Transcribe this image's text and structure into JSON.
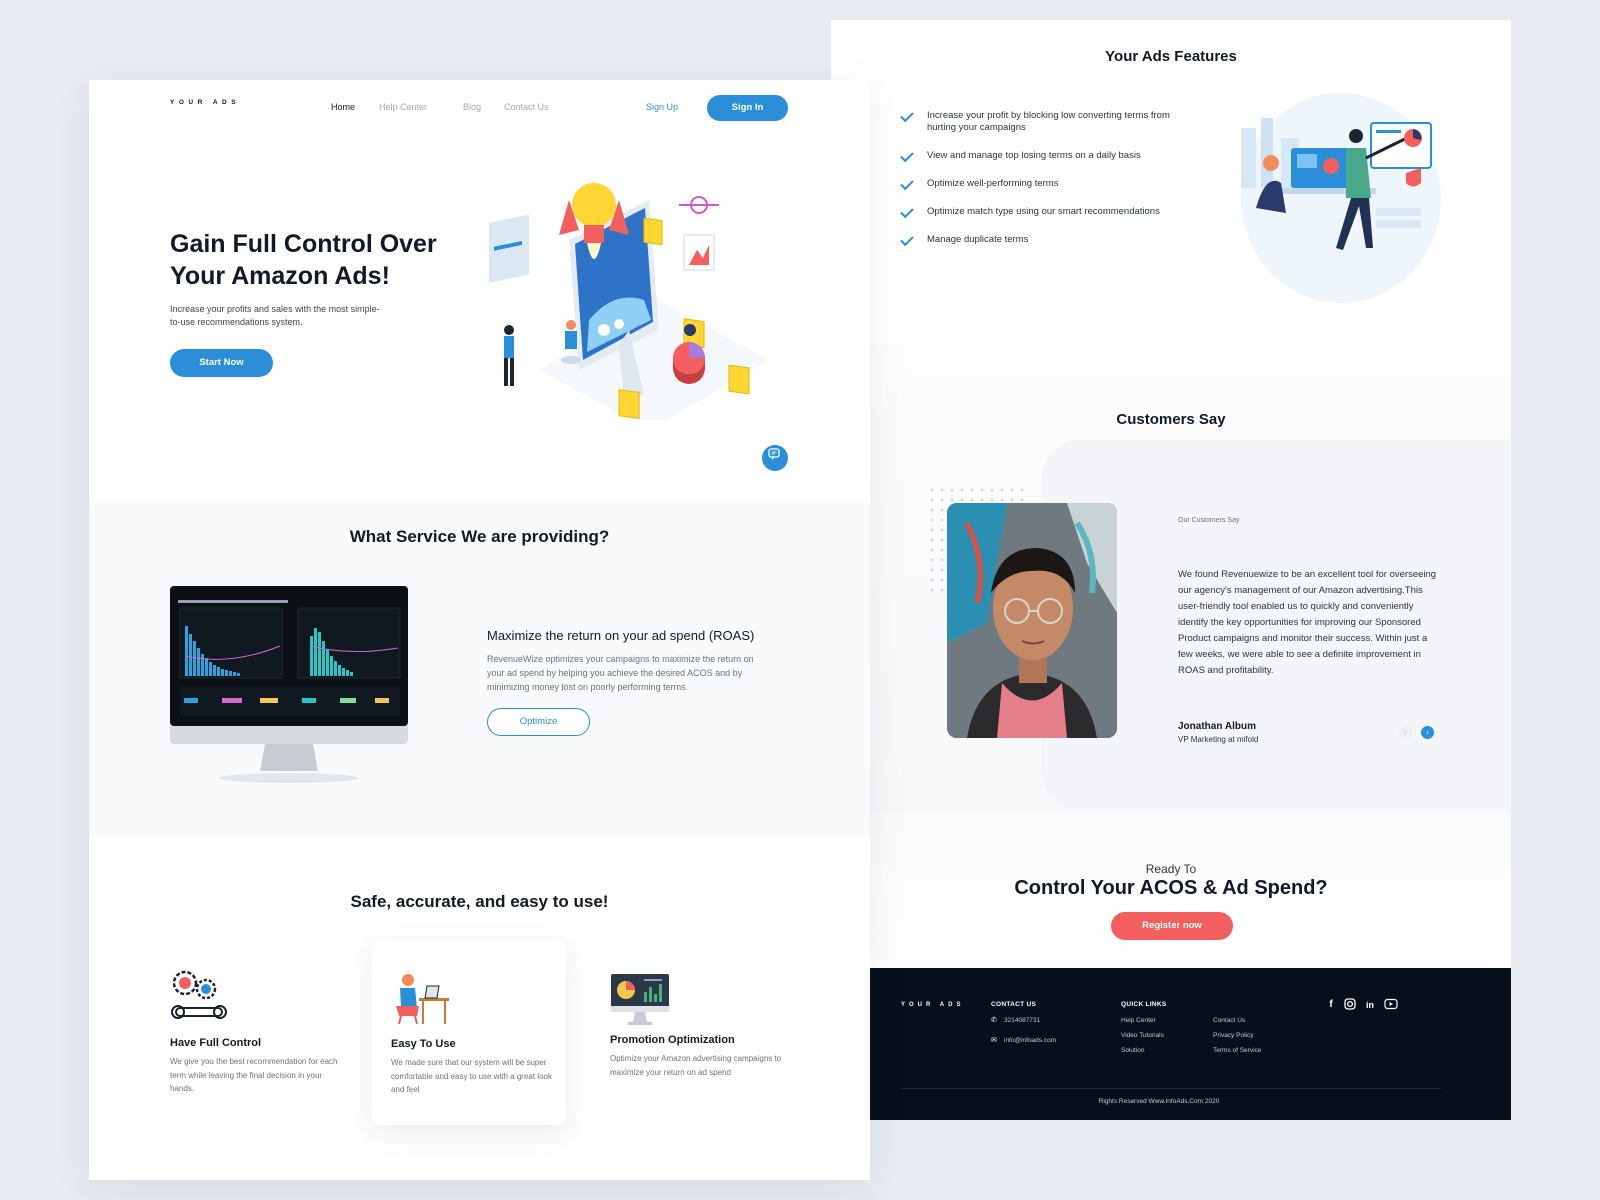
{
  "left_page": {
    "logo": "YOUR ADS",
    "nav": [
      {
        "label": "Home",
        "active": true
      },
      {
        "label": "Help Center",
        "active": false
      },
      {
        "label": "Blog",
        "active": false
      },
      {
        "label": "Contact Us",
        "active": false
      }
    ],
    "sign_up": "Sign Up",
    "sign_in": "Sign In",
    "hero": {
      "title": "Gain Full Control Over Your Amazon Ads!",
      "subtitle": "Increase your profits and sales with the most simple-to-use recommendations system.",
      "cta": "Start Now"
    },
    "service": {
      "heading": "What Service We are providing?",
      "title": "Maximize the return on your ad spend (ROAS)",
      "description": "RevenueWize optimizes your campaigns to maximize the return on your ad spend by helping you achieve the desired ACOS and by minimizing money lost on poorly performing terms.",
      "button": "Optimize"
    },
    "safe": {
      "heading": "Safe, accurate, and easy to use!",
      "tiles": [
        {
          "title": "Have Full Control",
          "desc": "We give you the best recommendation for each term while leaving the final decision in your hands.",
          "icon": "gears-wrench-icon"
        },
        {
          "title": "Easy To Use",
          "desc": "We made sure that our system will be super comfortable and easy to use with a great look and feel",
          "icon": "person-desk-icon"
        },
        {
          "title": "Promotion Optimization",
          "desc": "Optimize your Amazon advertising campaigns to maximize your return on ad spend",
          "icon": "monitor-chart-icon"
        }
      ]
    }
  },
  "right_page": {
    "features": {
      "heading": "Your Ads Features",
      "items": [
        "Increase your profit by blocking low converting terms from hurting your campaigns",
        "View and manage top losing terms on a daily basis",
        "Optimize well-performing terms",
        "Optimize match type using our smart recommendations",
        "Manage duplicate terms"
      ]
    },
    "customers": {
      "heading": "Customers Say",
      "label": "Our Customers Say",
      "quote": "We found Revenuewize to be an excellent tool for overseeing our agency's management of our Amazon advertising.This user-friendly tool enabled us to quickly and conveniently identify the key opportunities for improving our Sponsored Product campaigns and monitor their success. Within just a few weeks, we were able to see a definite improvement in ROAS and profitability.",
      "name": "Jonathan Album",
      "role": "VP Marketing at mifold"
    },
    "cta": {
      "small": "Ready To",
      "big": "Control Your ACOS & Ad Spend?",
      "button": "Register now"
    },
    "footer": {
      "logo": "YOUR ADS",
      "contact_title": "CONTACT US",
      "phone": "3214087731",
      "email": "info@infoads.com",
      "quick_title": "QUICK LINKS",
      "links_col1": [
        "Help Center",
        "Video Tutorials",
        "Solution"
      ],
      "links_col2": [
        "Contact Us",
        "Privacy Policy",
        "Terms of Service"
      ],
      "copyright": "Rights Reserved Www.InfoAds.Com 2020"
    }
  },
  "colors": {
    "accent": "#2a8fd8",
    "cta_red": "#f35f5f",
    "footer_bg": "#070f1a",
    "text_dark": "#111a26"
  }
}
